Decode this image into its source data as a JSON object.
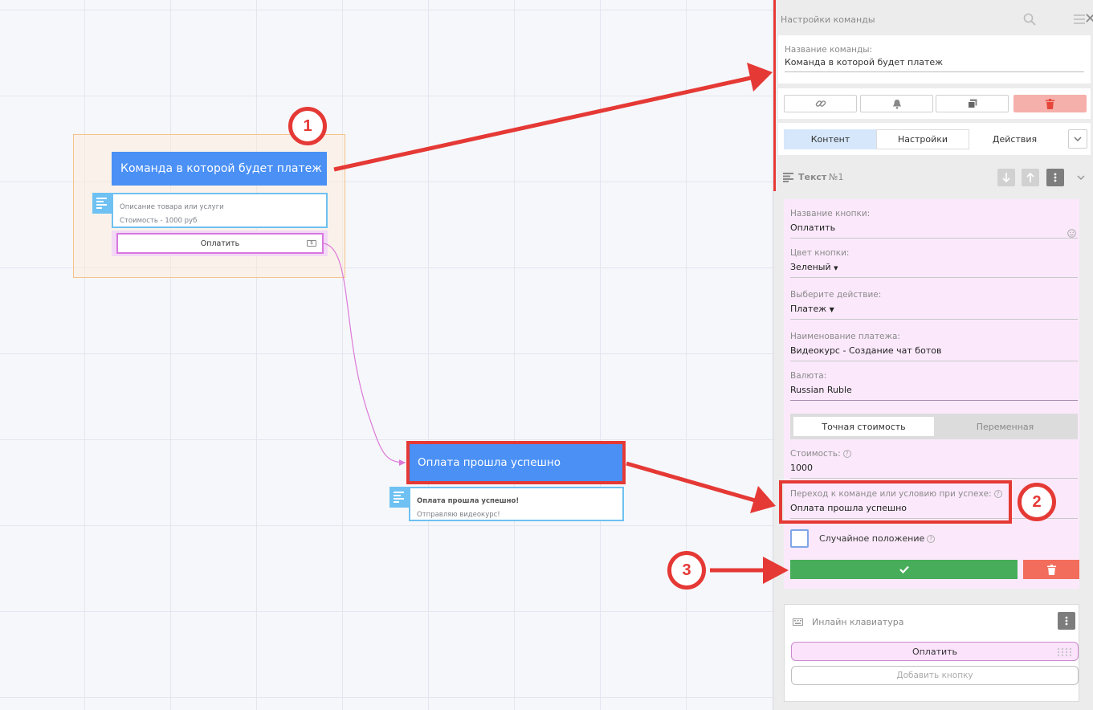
{
  "canvas": {
    "node1": {
      "title": "Команда в которой будет платеж",
      "text_lines": [
        "Описание товара или услуги",
        "Стоимость - 1000 руб"
      ],
      "button_label": "Оплатить"
    },
    "node2": {
      "title": "Оплата прошла успешно",
      "text_lines": [
        "Оплата прошла успешно!",
        "Отправляю видеокурс!"
      ]
    }
  },
  "annotations": {
    "badge1": "1",
    "badge2": "2",
    "badge3": "3",
    "color": "#e53935"
  },
  "panel": {
    "title": "Настройки команды",
    "command_name": {
      "label": "Название команды:",
      "value": "Команда в которой будет платеж"
    },
    "actions": [
      "link-icon",
      "bell-icon",
      "copy-icon",
      "trash-icon"
    ],
    "tabs": [
      {
        "label": "Контент",
        "active": true
      },
      {
        "label": "Настройки",
        "active": false
      },
      {
        "label": "Действия",
        "active": false
      }
    ],
    "block": {
      "title": "Текст",
      "number": "№1"
    },
    "form": {
      "button_name": {
        "label": "Название кнопки:",
        "value": "Оплатить"
      },
      "button_color": {
        "label": "Цвет кнопки:",
        "value": "Зеленый"
      },
      "action": {
        "label": "Выберите действие:",
        "value": "Платеж"
      },
      "payment_name": {
        "label": "Наименование платежа:",
        "value": "Видеокурс - Создание чат ботов"
      },
      "currency": {
        "label": "Валюта:",
        "value": "Russian Ruble"
      },
      "price_mode": {
        "options": [
          "Точная стоимость",
          "Переменная"
        ],
        "selected": "Точная стоимость"
      },
      "price": {
        "label": "Стоимость:",
        "value": "1000"
      },
      "on_success": {
        "label": "Переход к команде или условию при успехе:",
        "value": "Оплата прошла успешно"
      },
      "random_position": {
        "label": "Случайное положение",
        "checked": false
      }
    },
    "keyboard": {
      "title": "Инлайн клавиатура",
      "buttons": [
        "Оплатить"
      ],
      "add_button": "Добавить кнопку"
    }
  },
  "colors": {
    "node_title": "#4a90f5",
    "text_border": "#6ec1f2",
    "save": "#47ad5a",
    "delete": "#f26d5b",
    "tab_active": "#d6e7fb"
  }
}
